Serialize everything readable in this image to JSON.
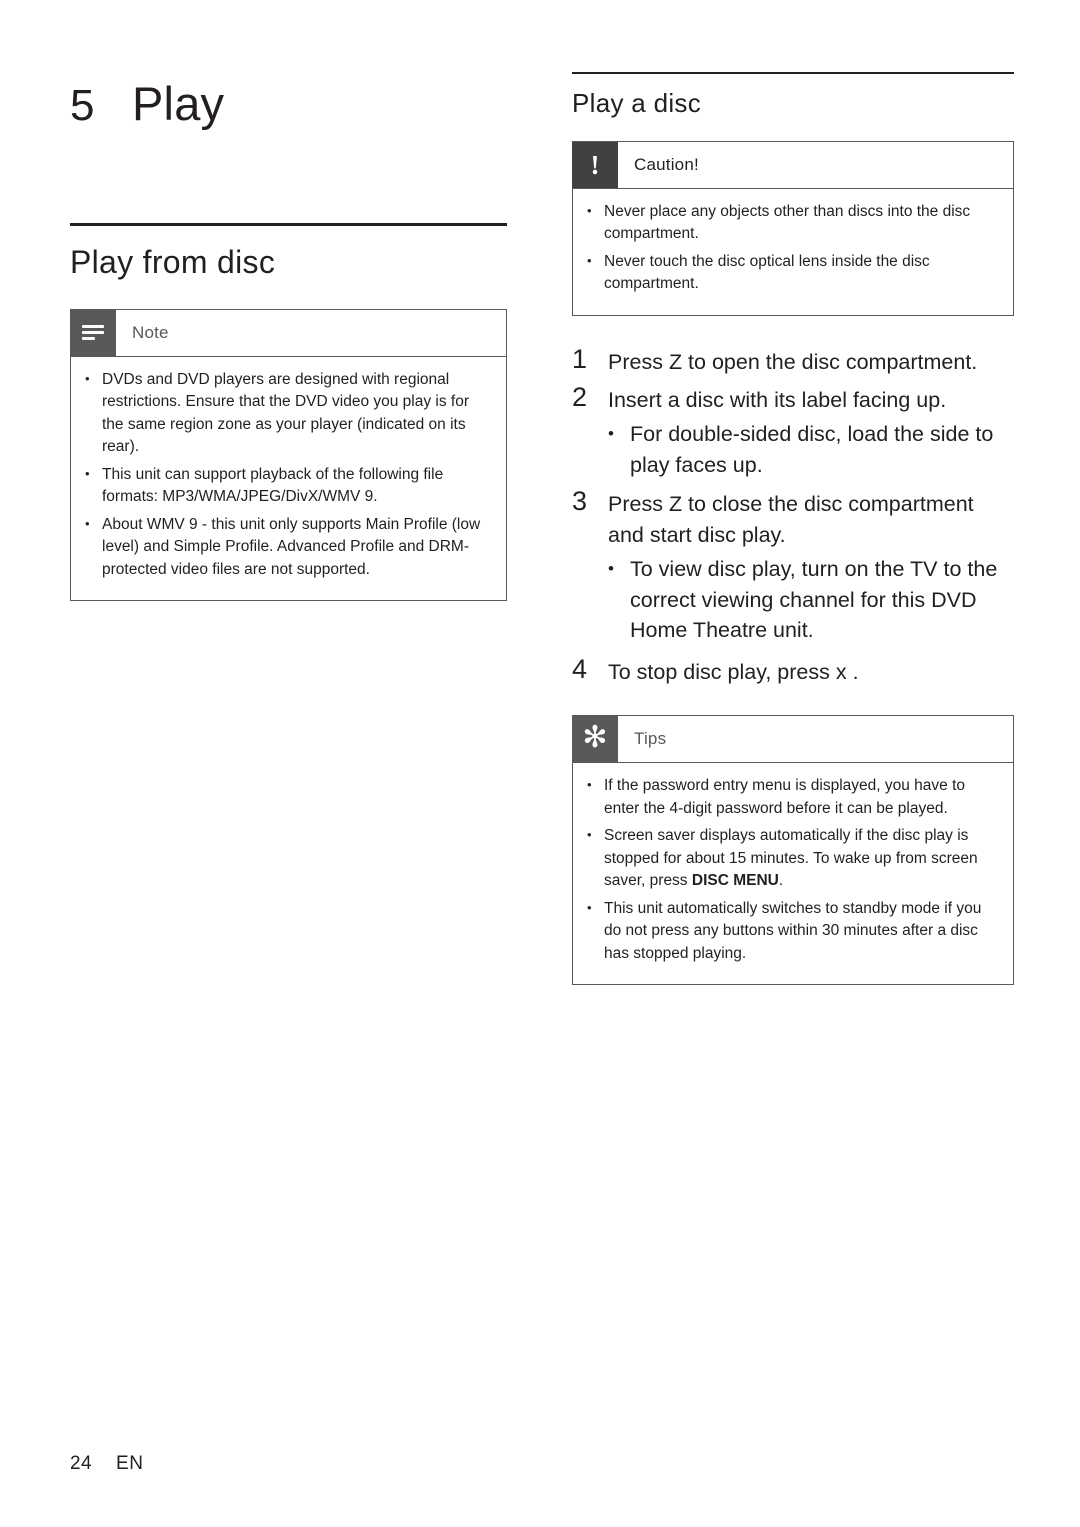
{
  "chapter": {
    "number": "5",
    "title": "Play"
  },
  "left": {
    "section_title": "Play from disc",
    "note": {
      "icon": "note-lines-icon",
      "label": "Note",
      "items": [
        "DVDs and DVD players are designed with regional restrictions.  Ensure that the DVD video you play is for the same region zone as your player (indicated on its rear).",
        "This unit can support playback of the following file formats: MP3/WMA/JPEG/DivX/WMV 9.",
        "About WMV 9 - this unit only supports Main Profile (low level) and Simple Profile.  Advanced Profile and DRM-protected video files are not supported."
      ]
    }
  },
  "right": {
    "section_title": "Play a disc",
    "caution": {
      "icon": "exclamation-icon",
      "label": "Caution!",
      "items": [
        "Never place any objects other than discs into the disc compartment.",
        "Never touch the disc optical lens inside the disc compartment."
      ]
    },
    "steps": [
      {
        "number": "1",
        "text_before": "Press ",
        "key": "Z",
        "text_after": " to open the disc compartment.",
        "subs": []
      },
      {
        "number": "2",
        "text_before": "Insert a disc with its label facing up.",
        "key": "",
        "text_after": "",
        "subs": [
          "For double-sided disc, load the side to play faces up."
        ]
      },
      {
        "number": "3",
        "text_before": "Press ",
        "key": "Z",
        "text_after": " to close the disc compartment and start disc play.",
        "subs": [
          "To view disc play, turn on the TV to the correct viewing channel for this DVD Home Theatre unit."
        ]
      },
      {
        "number": "4",
        "text_before": "To stop disc play, press ",
        "key": "x",
        "text_after": " .",
        "subs": []
      }
    ],
    "tips": {
      "icon": "star-icon",
      "label": "Tips",
      "items": [
        "If the password entry menu is displayed, you have to enter the 4-digit password before it can be played.",
        "Screen saver displays automatically if the disc play is stopped for about 15 minutes. To wake up from screen saver, press DISC MENU.",
        "This unit automatically switches to standby mode if you do not press any buttons within 30 minutes after a disc has stopped playing."
      ],
      "bold_fragment": "DISC MENU"
    }
  },
  "footer": {
    "page_number": "24",
    "language": "EN"
  },
  "colors": {
    "text": "#231f20",
    "badge_gray": "#58595b",
    "badge_dark": "#414042",
    "rule": "#231f20"
  }
}
